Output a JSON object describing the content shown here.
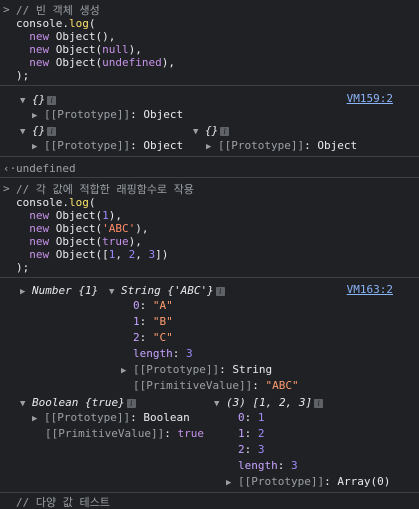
{
  "block1": {
    "comment": "// 빈 객체 생성",
    "code": [
      "console.log(",
      "  new Object(),",
      "  new Object(null),",
      "  new Object(undefined),",
      ");"
    ]
  },
  "output1": {
    "source": "VM159:2",
    "obj_label": "{}",
    "prototype_label": "[[Prototype]]",
    "prototype_value": "Object"
  },
  "undefined_result": "undefined",
  "block2": {
    "comment": "// 각 값에 적합한 래핑함수로 작용",
    "code": [
      "console.log(",
      "  new Object(1),",
      "  new Object('ABC'),",
      "  new Object(true),",
      "  new Object([1, 2, 3])",
      ");"
    ]
  },
  "output2": {
    "source": "VM163:2",
    "number_label": "Number {1}",
    "string_label": "String {'ABC'}",
    "string_props": [
      {
        "key": "0",
        "value": "\"A\""
      },
      {
        "key": "1",
        "value": "\"B\""
      },
      {
        "key": "2",
        "value": "\"C\""
      }
    ],
    "length_key": "length",
    "length_value": "3",
    "string_proto": "String",
    "primitive_label": "[[PrimitiveValue]]",
    "string_primitive": "\"ABC\"",
    "boolean_label": "Boolean {true}",
    "boolean_proto": "Boolean",
    "boolean_primitive": "true",
    "array_label": "(3) [1, 2, 3]",
    "array_props": [
      {
        "key": "0",
        "value": "1"
      },
      {
        "key": "1",
        "value": "2"
      },
      {
        "key": "2",
        "value": "3"
      }
    ],
    "array_length": "3",
    "array_proto": "Array(0)"
  },
  "last_comment": "// 다양 값 테스트"
}
